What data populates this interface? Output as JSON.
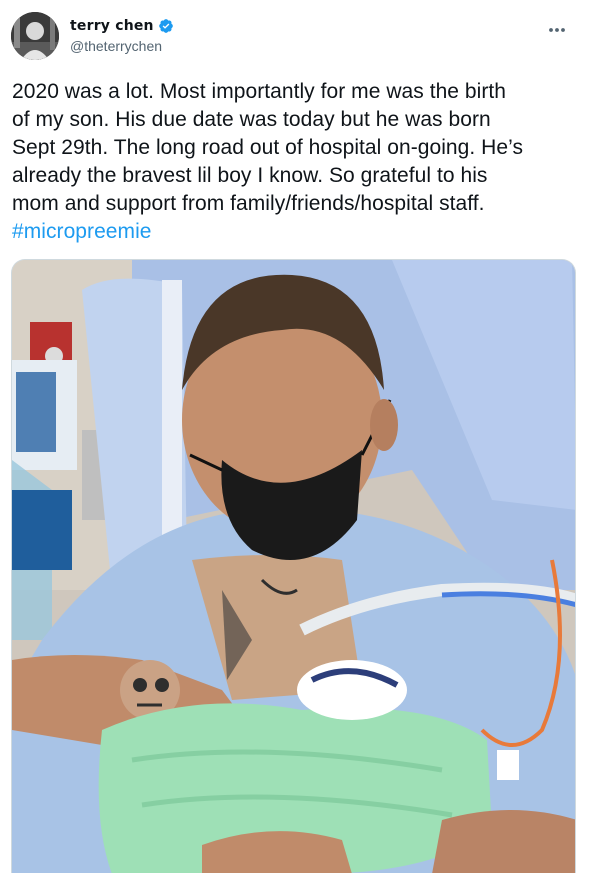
{
  "user": {
    "display_name": "terry chen",
    "handle": "@theterrychen",
    "verified": true,
    "avatar_icon": "avatar-photo"
  },
  "tweet": {
    "line1": "2020 was a lot. Most importantly for me was the birth",
    "line2": "of my son. His due date was today but he was born",
    "line3": "Sept 29th. The long road out of hospital on-going. He’s",
    "line4": "already the bravest lil boy I know. So grateful to his",
    "line5": "mom and support from family/friends/hospital staff.",
    "hashtag": "#micropreemie"
  },
  "icons": {
    "more": "more-horizontal-icon",
    "verified": "verified-badge-icon"
  },
  "colors": {
    "accent": "#1d9bf0",
    "text": "#0f1419",
    "secondary": "#536471"
  }
}
